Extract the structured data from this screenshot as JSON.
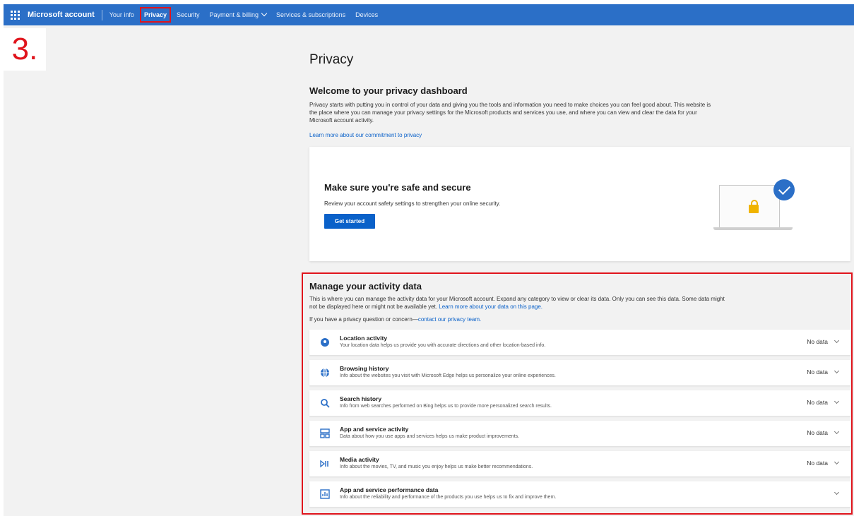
{
  "nav": {
    "brand": "Microsoft account",
    "items": [
      "Your info",
      "Privacy",
      "Security",
      "Payment & billing",
      "Services & subscriptions",
      "Devices"
    ],
    "active": "Privacy"
  },
  "step_label": "3.",
  "page": {
    "title": "Privacy",
    "welcome_heading": "Welcome to your privacy dashboard",
    "welcome_text": "Privacy starts with putting you in control of your data and giving you the tools and information you need to make choices you can feel good about. This website is the place where you can manage your privacy settings for the Microsoft products and services you use, and where you can view and clear the data for your Microsoft account activity.",
    "welcome_link": "Learn more about our commitment to privacy"
  },
  "safe_card": {
    "heading": "Make sure you're safe and secure",
    "text": "Review your account safety settings to strengthen your online security.",
    "button": "Get started"
  },
  "manage": {
    "heading": "Manage your activity data",
    "text_before_link": "This is where you can manage the activity data for your Microsoft account. Expand any category to view or clear its data. Only you can see this data. Some data might not be displayed here or might not be available yet.",
    "text_link": "Learn more about your data on this page.",
    "question": "If you have a privacy question or concern—",
    "question_link": "contact our privacy team."
  },
  "rows": [
    {
      "title": "Location activity",
      "desc": "Your location data helps us provide you with accurate directions and other location-based info.",
      "status": "No data",
      "icon": "location-pin-icon"
    },
    {
      "title": "Browsing history",
      "desc": "Info about the websites you visit with Microsoft Edge helps us personalize your online experiences.",
      "status": "No data",
      "icon": "globe-icon"
    },
    {
      "title": "Search history",
      "desc": "Info from web searches performed on Bing helps us to provide more personalized search results.",
      "status": "No data",
      "icon": "search-icon"
    },
    {
      "title": "App and service activity",
      "desc": "Data about how you use apps and services helps us make product improvements.",
      "status": "No data",
      "icon": "apps-icon"
    },
    {
      "title": "Media activity",
      "desc": "Info about the movies, TV, and music you enjoy helps us make better recommendations.",
      "status": "No data",
      "icon": "media-icon"
    },
    {
      "title": "App and service performance data",
      "desc": "Info about the reliability and performance of the products you use helps us to fix and improve them.",
      "status": "",
      "icon": "performance-icon"
    }
  ],
  "colors": {
    "nav_bg": "#2b6fc7",
    "accent": "#0a61c9",
    "highlight": "#e0141c",
    "lock": "#f0b400"
  }
}
